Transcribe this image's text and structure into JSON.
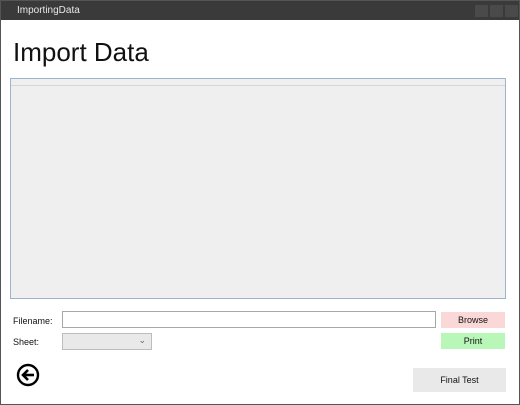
{
  "window": {
    "title": "ImportingData"
  },
  "page": {
    "heading": "Import Data"
  },
  "form": {
    "filename_label": "Filename:",
    "filename_value": "",
    "sheet_label": "Sheet:",
    "sheet_value": ""
  },
  "buttons": {
    "browse": "Browse",
    "print": "Print",
    "final_test": "Final Test"
  },
  "icons": {
    "back": "back-arrow-icon"
  },
  "colors": {
    "browse_bg": "#fbd8d8",
    "print_bg": "#b8f7b8",
    "titlebar_bg": "#3a3a3a"
  }
}
